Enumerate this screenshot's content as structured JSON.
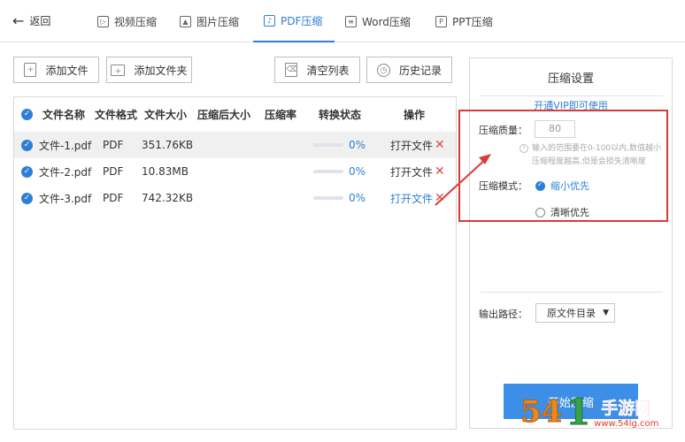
{
  "topbar": {
    "back_label": "返回",
    "tabs": [
      {
        "label": "视频压缩",
        "icon": "video-icon"
      },
      {
        "label": "图片压缩",
        "icon": "image-icon"
      },
      {
        "label": "PDF压缩",
        "icon": "pdf-icon",
        "active": true
      },
      {
        "label": "Word压缩",
        "icon": "word-icon"
      },
      {
        "label": "PPT压缩",
        "icon": "ppt-icon"
      }
    ]
  },
  "toolbar": {
    "add_file": "添加文件",
    "add_folder": "添加文件夹",
    "clear_list": "清空列表",
    "history": "历史记录"
  },
  "table": {
    "headers": [
      "文件名称",
      "文件格式",
      "文件大小",
      "压缩后大小",
      "压缩率",
      "转换状态",
      "操作"
    ],
    "rows": [
      {
        "name": "文件-1.pdf",
        "format": "PDF",
        "size": "351.76KB",
        "compressed": "",
        "rate": "",
        "progress": "0%",
        "action": "打开文件"
      },
      {
        "name": "文件-2.pdf",
        "format": "PDF",
        "size": "10.83MB",
        "compressed": "",
        "rate": "",
        "progress": "0%",
        "action": "打开文件"
      },
      {
        "name": "文件-3.pdf",
        "format": "PDF",
        "size": "742.32KB",
        "compressed": "",
        "rate": "",
        "progress": "0%",
        "action": "打开文件"
      }
    ]
  },
  "settings": {
    "title": "压缩设置",
    "vip_link": "开通VIP即可使用",
    "quality_label": "压缩质量：",
    "quality_value": "80",
    "hint": "输入的范围要在0-100以内,数值越小压缩程度越高,但是会损失清晰度",
    "mode_label": "压缩模式：",
    "mode_options": [
      "缩小优先",
      "清晰优先"
    ],
    "mode_selected": "缩小优先",
    "output_label": "输出路径：",
    "output_value": "原文件目录",
    "start_button": "开始压缩"
  },
  "watermark": {
    "num": "54",
    "mid": "1",
    "cn": "手游网",
    "url": "www.54lg.com"
  },
  "colors": {
    "accent": "#2d7fd6",
    "highlight": "#d93a3a",
    "button": "#3d8ee6"
  }
}
